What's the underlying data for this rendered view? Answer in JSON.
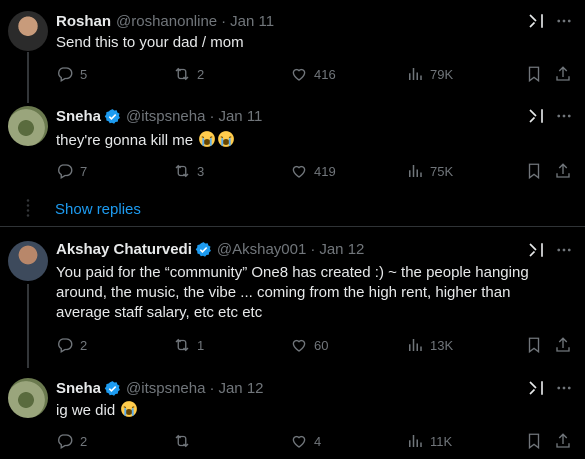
{
  "tweets": [
    {
      "name": "Roshan",
      "handle": "@roshanonline",
      "sep": "·",
      "date": "Jan 11",
      "verified": false,
      "text": "Send this to your dad / mom",
      "replies": "5",
      "retweets": "2",
      "likes": "416",
      "views": "79K"
    },
    {
      "name": "Sneha",
      "handle": "@itspsneha",
      "sep": "·",
      "date": "Jan 11",
      "verified": true,
      "text": "they're gonna kill me",
      "emoji": "loudly-crying-face x2",
      "replies": "7",
      "retweets": "3",
      "likes": "419",
      "views": "75K"
    },
    {
      "name": "Akshay Chaturvedi",
      "handle": "@Akshay001",
      "sep": "·",
      "date": "Jan 12",
      "verified": true,
      "text": "You paid for the “community” One8 has created :) ~ the people hanging around, the music, the vibe ... coming from the high rent, higher than average staff salary, etc etc etc",
      "replies": "2",
      "retweets": "1",
      "likes": "60",
      "views": "13K"
    },
    {
      "name": "Sneha",
      "handle": "@itspsneha",
      "sep": "·",
      "date": "Jan 12",
      "verified": true,
      "text": "ig we did",
      "emoji": "loudly-crying-face",
      "replies": "2",
      "retweets": "",
      "likes": "4",
      "views": "11K"
    }
  ],
  "show_replies": "Show replies",
  "colors": {
    "background": "#000000",
    "text": "#e7e9ea",
    "muted": "#71767b",
    "accent": "#1d9bf0",
    "divider": "#2f3336"
  }
}
